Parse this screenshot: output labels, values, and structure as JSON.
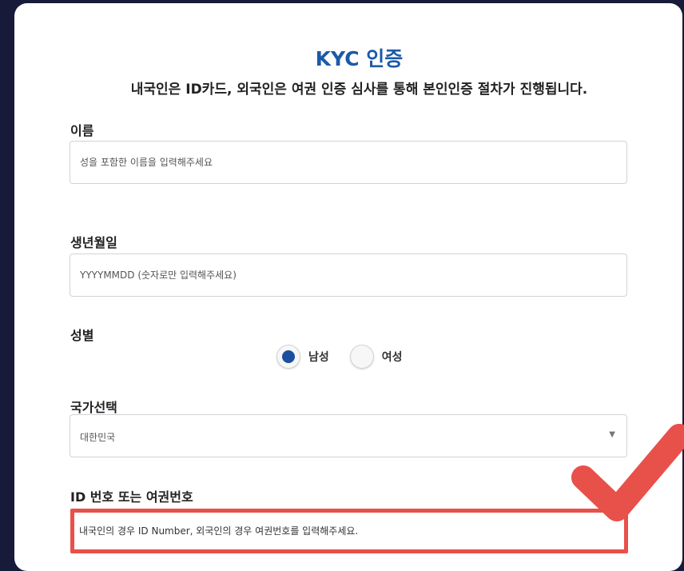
{
  "header": {
    "title": "KYC 인증",
    "subtitle": "내국인은 ID카드, 외국인은 여권 인증 심사를 통해 본인인증 절차가 진행됩니다."
  },
  "form": {
    "name": {
      "label": "이름",
      "placeholder": "성을 포함한 이름을 입력해주세요"
    },
    "birthdate": {
      "label": "생년월일",
      "placeholder": "YYYYMMDD (숫자로만 입력해주세요)"
    },
    "gender": {
      "label": "성별",
      "options": [
        {
          "label": "남성",
          "selected": true
        },
        {
          "label": "여성",
          "selected": false
        }
      ]
    },
    "country": {
      "label": "국가선택",
      "selected_value": "대한민국"
    },
    "id_number": {
      "label": "ID 번호 또는 여권번호",
      "placeholder": "내국인의 경우 ID Number, 외국인의 경우 여권번호를 입력해주세요."
    }
  },
  "annotation": {
    "highlight_color": "#e8504a",
    "icon": "checkmark-icon"
  },
  "colors": {
    "title": "#1a5aa8",
    "radio_selected": "#1a4f9f",
    "background": "#181a3a"
  }
}
